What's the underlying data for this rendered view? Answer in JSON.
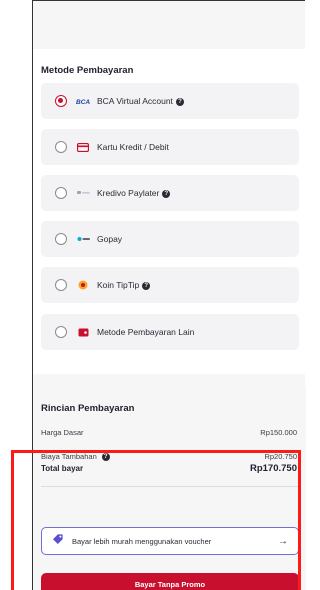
{
  "payment": {
    "title": "Metode Pembayaran",
    "methods": [
      {
        "label": "BCA Virtual Account",
        "logo": "BCA",
        "selected": true,
        "info": true
      },
      {
        "label": "Kartu Kredit / Debit",
        "logo": "card-icon",
        "selected": false,
        "info": false
      },
      {
        "label": "Kredivo Paylater",
        "logo": "kredivo-logo",
        "selected": false,
        "info": true
      },
      {
        "label": "Gopay",
        "logo": "gopay-logo",
        "selected": false,
        "info": false
      },
      {
        "label": "Koin TipTip",
        "logo": "coin-icon",
        "selected": false,
        "info": true
      },
      {
        "label": "Metode Pembayaran Lain",
        "logo": "wallet-icon",
        "selected": false,
        "info": false
      }
    ]
  },
  "details": {
    "title": "Rincian Pembayaran",
    "rows": [
      {
        "label": "Harga Dasar",
        "value": "Rp150.000"
      },
      {
        "label": "Biaya Tambahan",
        "value": "Rp20.750"
      }
    ],
    "total_label": "Total bayar",
    "total_value": "Rp170.750"
  },
  "voucher": {
    "label": "Bayar lebih murah menggunakan voucher",
    "arrow": "→"
  },
  "cta": {
    "label": "Bayar Tanpa Promo"
  },
  "colors": {
    "accent": "#c8102e",
    "voucher_border": "#6f6fd6",
    "highlight": "#ff1a1a"
  }
}
